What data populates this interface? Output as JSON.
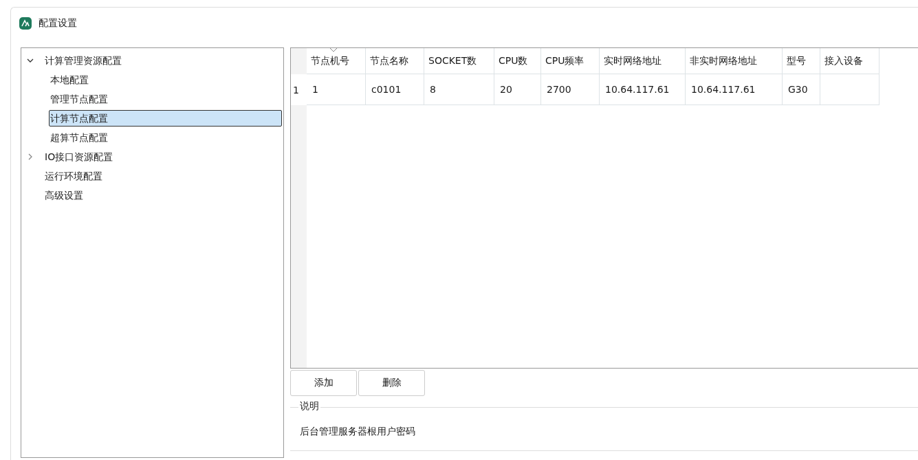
{
  "window": {
    "title": "配置设置"
  },
  "tree": [
    {
      "label": "计算管理资源配置",
      "expanded": true,
      "selected": false,
      "children": [
        {
          "label": "本地配置",
          "selected": false
        },
        {
          "label": "管理节点配置",
          "selected": false
        },
        {
          "label": "计算节点配置",
          "selected": true
        },
        {
          "label": "超算节点配置",
          "selected": false
        }
      ]
    },
    {
      "label": "IO接口资源配置",
      "expanded": false,
      "selected": false
    },
    {
      "label": "运行环境配置",
      "selected": false
    },
    {
      "label": "高级设置",
      "selected": false
    }
  ],
  "table": {
    "columns": [
      "节点机号",
      "节点名称",
      "SOCKET数",
      "CPU数",
      "CPU频率",
      "实时网络地址",
      "非实时网络地址",
      "型号",
      "接入设备"
    ],
    "rows": [
      {
        "row_number": "1",
        "cells": [
          "1",
          "c0101",
          "8",
          "20",
          "2700",
          "10.64.117.61",
          "10.64.117.61",
          "G30",
          ""
        ]
      }
    ]
  },
  "buttons": [
    "添加",
    "删除"
  ],
  "description": {
    "title": "说明",
    "text": "后台管理服务器根用户密码"
  }
}
